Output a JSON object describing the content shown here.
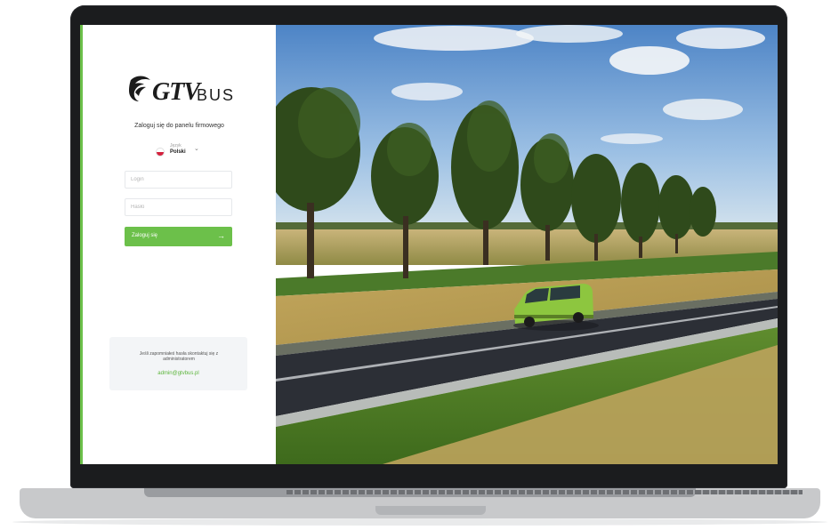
{
  "brand": {
    "logo_text": "GTV",
    "logo_suffix": "BUS"
  },
  "login": {
    "subtitle": "Zaloguj się do panelu firmowego",
    "language": {
      "caption": "Język",
      "value": "Polski",
      "flag_icon": "poland-flag-icon",
      "chevron_icon": "chevron-down-icon"
    },
    "login_field": {
      "placeholder": "Login",
      "value": ""
    },
    "password_field": {
      "placeholder": "Hasło",
      "value": ""
    },
    "submit_label": "Zaloguj się",
    "submit_icon": "arrow-right-icon"
  },
  "help": {
    "text": "Jeśli zapomniałeś hasła skontaktuj się z administratorem",
    "email": "admin@gtvbus.pl"
  },
  "colors": {
    "accent": "#6cc04a",
    "van": "#8dc63f",
    "road": "#2c2f36"
  }
}
